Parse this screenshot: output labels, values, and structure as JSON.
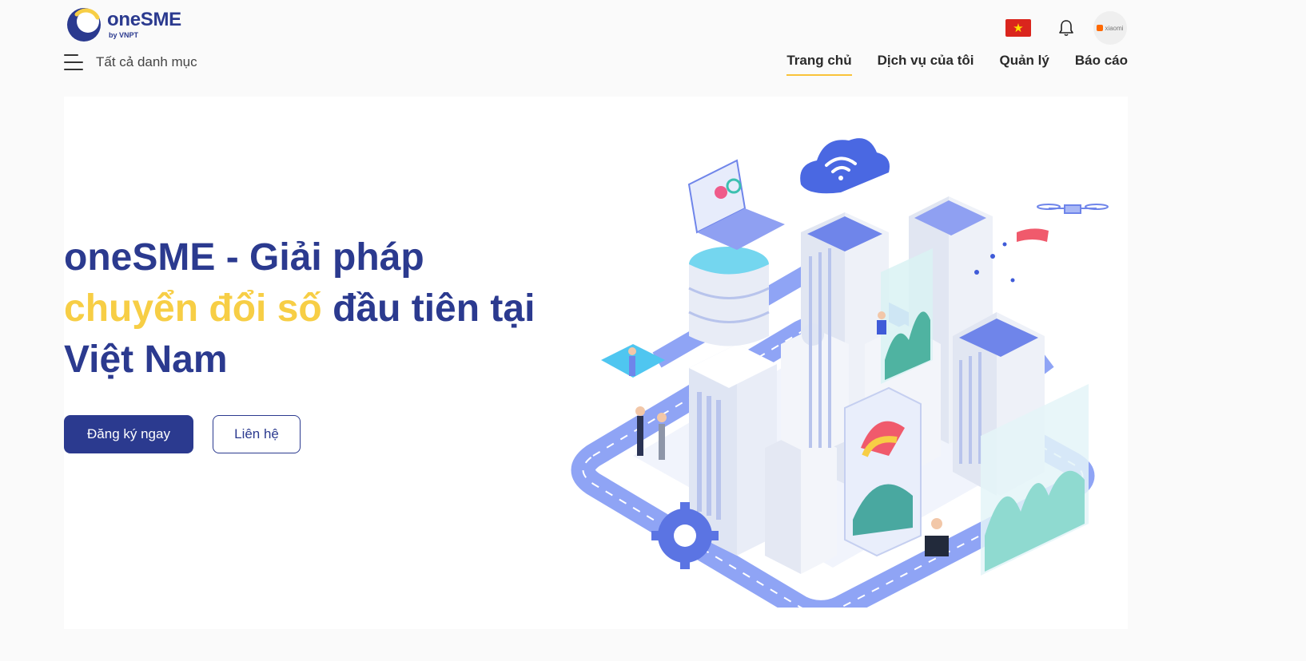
{
  "header": {
    "logo_name": "oneSME",
    "logo_sub": "by VNPT",
    "language_flag": "vn-flag",
    "notification_icon": "bell-icon",
    "avatar_text": "xiaomi",
    "category_label": "Tất cả danh mục",
    "nav": [
      {
        "label": "Trang chủ",
        "active": true
      },
      {
        "label": "Dịch vụ của tôi",
        "active": false
      },
      {
        "label": "Quản lý",
        "active": false
      },
      {
        "label": "Báo cáo",
        "active": false
      }
    ]
  },
  "hero": {
    "headline_part1": "oneSME - Giải pháp",
    "headline_accent": "chuyển đổi số",
    "headline_part2": "đầu tiên tại Việt Nam",
    "primary_button": "Đăng ký ngay",
    "secondary_button": "Liên hệ",
    "illustration_icon": "smart-city-illustration"
  },
  "colors": {
    "brand": "#2b3a8f",
    "accent": "#f7ce45",
    "nav_underline": "#f9c33a",
    "page_bg": "#fafafa"
  }
}
